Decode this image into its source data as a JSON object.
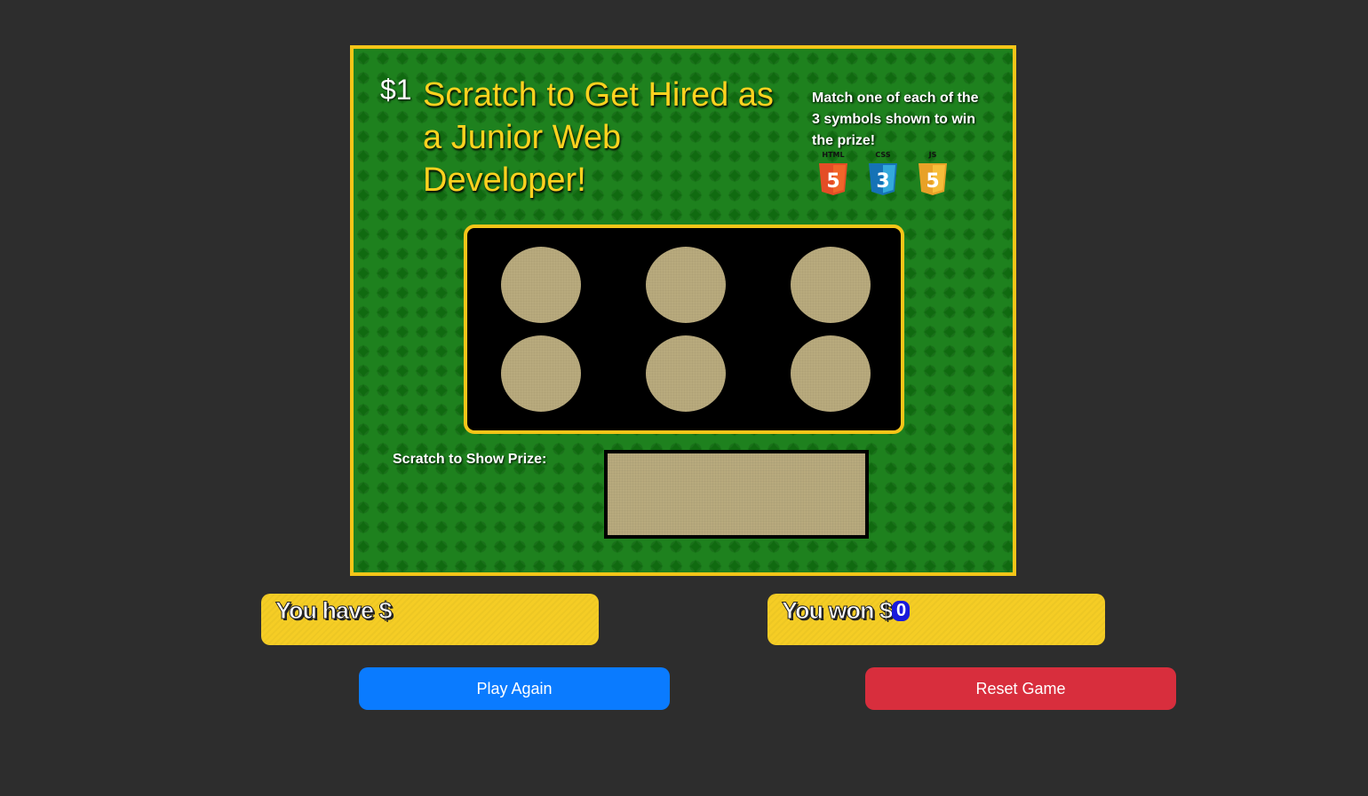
{
  "ticket": {
    "price": "$1",
    "title": "Scratch to Get Hired as a Junior Web Developer!",
    "instructions": "Match one of each of the 3 symbols shown to win the prize!",
    "symbols": [
      {
        "label": "HTML",
        "glyph": "5",
        "icon": "html5-shield-icon",
        "color": "#e44d26"
      },
      {
        "label": "CSS",
        "glyph": "3",
        "icon": "css3-shield-icon",
        "color": "#1572b6"
      },
      {
        "label": "JS",
        "glyph": "5",
        "icon": "js-shield-icon",
        "color": "#f0a12b"
      }
    ],
    "prize_label": "Scratch to Show Prize:"
  },
  "balance": {
    "prefix": "You have $",
    "value": ""
  },
  "winnings": {
    "prefix": "You won $",
    "value": "0"
  },
  "buttons": {
    "play_again": "Play Again",
    "reset": "Reset Game"
  },
  "colors": {
    "ticket_green": "#127a12",
    "gold": "#f5c518",
    "scratch_surface": "#b8aa7d",
    "primary": "#0a7bff",
    "danger": "#d82e3d"
  }
}
